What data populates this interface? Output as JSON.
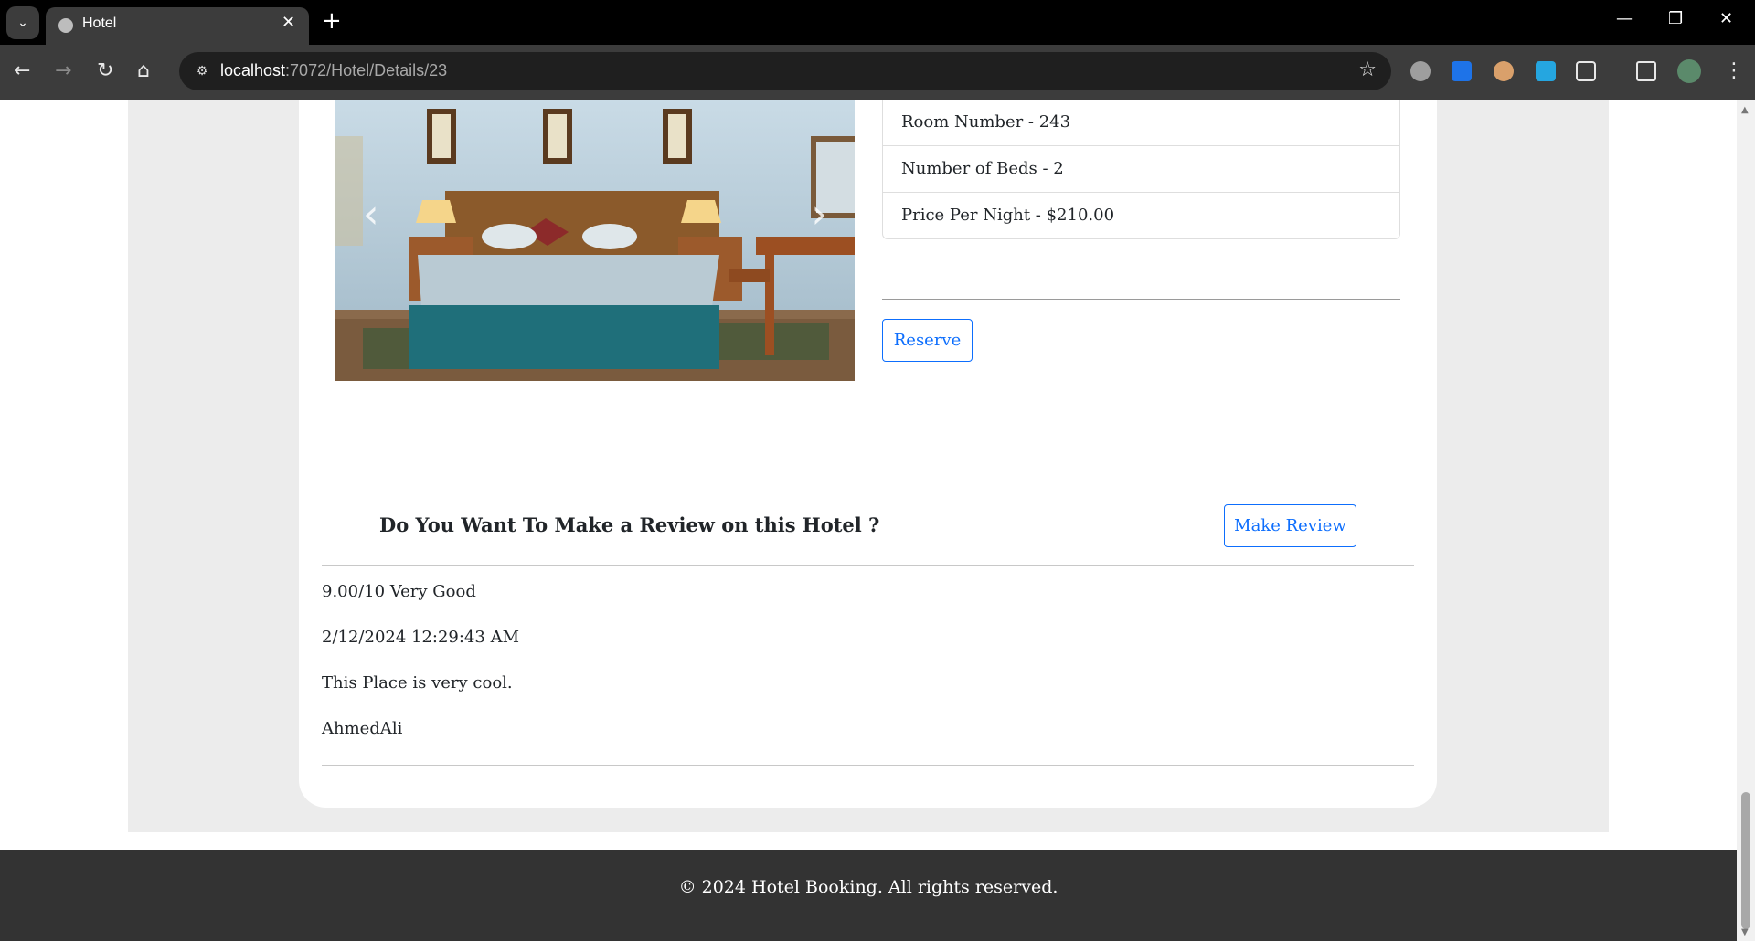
{
  "browser": {
    "tab_title": "Hotel",
    "tab_close": "✕",
    "new_tab": "+",
    "url_host": "localhost",
    "url_rest": ":7072/Hotel/Details/23"
  },
  "room": {
    "details": [
      "Room Number - 243",
      "Number of Beds - 2",
      "Price Per Night - $210.00"
    ],
    "reserve_label": "Reserve"
  },
  "review_section": {
    "question": "Do You Want To Make a Review on this Hotel ?",
    "make_review_label": "Make Review",
    "review": {
      "score": "9.00/10 Very Good",
      "date": "2/12/2024 12:29:43 AM",
      "comment": "This Place is very cool.",
      "author": "AhmedAli"
    }
  },
  "footer": {
    "text": "© 2024 Hotel Booking. All rights reserved."
  },
  "icons": {
    "back": "back-arrow-icon",
    "forward": "forward-arrow-icon",
    "reload": "reload-icon",
    "home": "home-icon",
    "bookmark": "star-icon"
  },
  "colors": {
    "primary": "#0d6efd",
    "page_bg": "#ececec",
    "footer_bg": "#333333",
    "chrome_bg": "#3c3c3c"
  }
}
